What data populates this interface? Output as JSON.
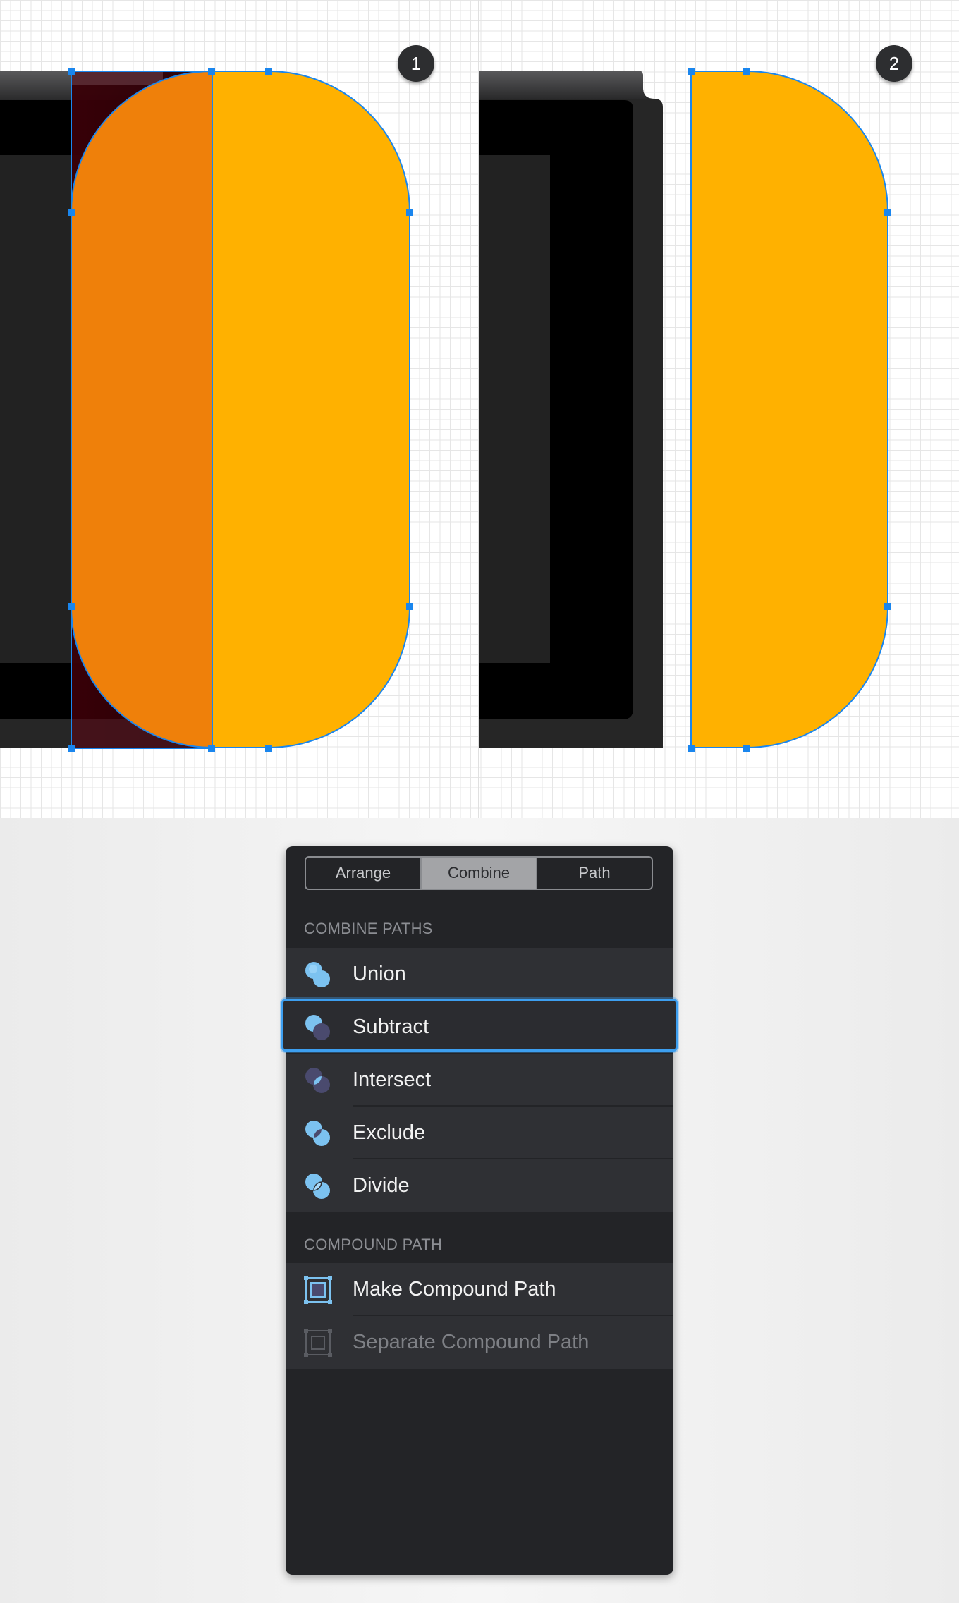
{
  "canvas": {
    "badges": [
      "1",
      "2"
    ],
    "colors": {
      "orange": "#ef800a",
      "yellow": "#ffb100",
      "selection_blue": "#1a86ee",
      "device_dark": "#232323"
    }
  },
  "panel": {
    "tabs": [
      {
        "label": "Arrange",
        "active": false
      },
      {
        "label": "Combine",
        "active": true
      },
      {
        "label": "Path",
        "active": false
      }
    ],
    "combine_section": {
      "title": "COMBINE PATHS",
      "items": [
        {
          "label": "Union",
          "icon": "union-icon",
          "selected": false
        },
        {
          "label": "Subtract",
          "icon": "subtract-icon",
          "selected": true
        },
        {
          "label": "Intersect",
          "icon": "intersect-icon",
          "selected": false
        },
        {
          "label": "Exclude",
          "icon": "exclude-icon",
          "selected": false
        },
        {
          "label": "Divide",
          "icon": "divide-icon",
          "selected": false
        }
      ]
    },
    "compound_section": {
      "title": "COMPOUND PATH",
      "items": [
        {
          "label": "Make Compound Path",
          "icon": "make-compound-path-icon",
          "enabled": true
        },
        {
          "label": "Separate Compound Path",
          "icon": "separate-compound-path-icon",
          "enabled": false
        }
      ]
    }
  }
}
